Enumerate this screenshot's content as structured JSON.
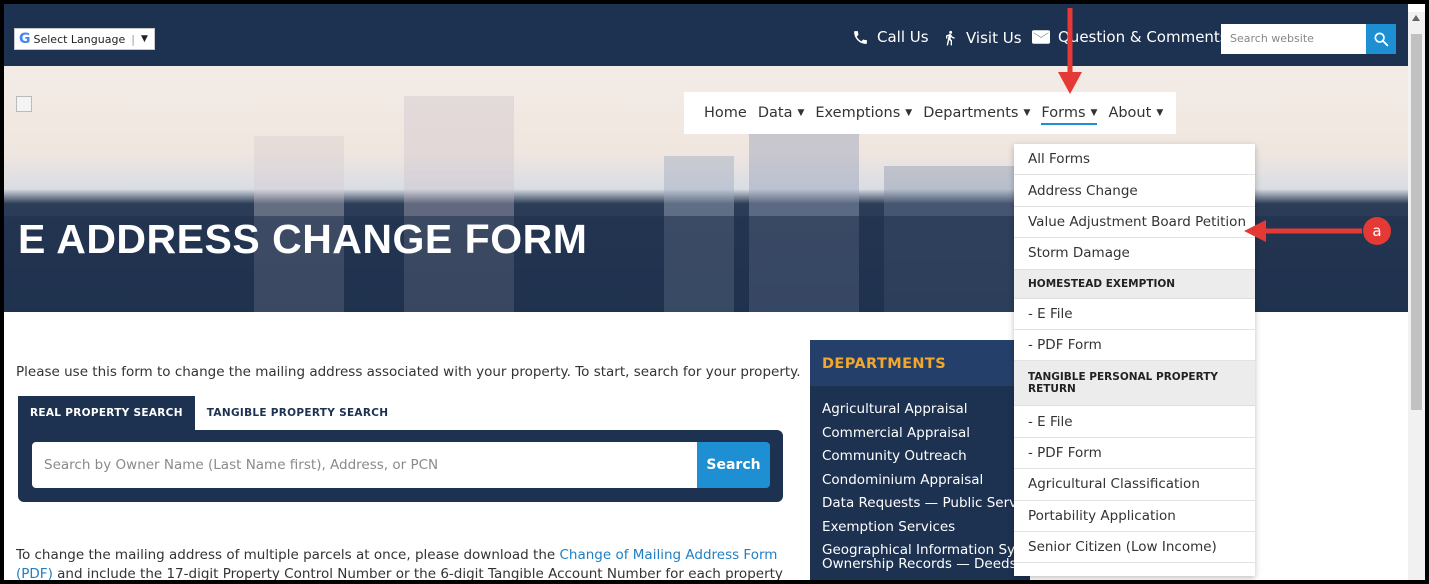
{
  "topbar": {
    "language_label": "Select Language",
    "call_label": "Call Us",
    "visit_label": "Visit Us",
    "question_label": "Question & Comments",
    "search_placeholder": "Search website"
  },
  "nav": {
    "items": [
      {
        "label": "Home"
      },
      {
        "label": "Data"
      },
      {
        "label": "Exemptions"
      },
      {
        "label": "Departments"
      },
      {
        "label": "Forms"
      },
      {
        "label": "About"
      }
    ]
  },
  "hero": {
    "title": "E ADDRESS CHANGE FORM"
  },
  "main": {
    "intro": "Please use this form to change the mailing address associated with your property. To start, search for your property.",
    "tabs": [
      {
        "label": "REAL PROPERTY SEARCH"
      },
      {
        "label": "TANGIBLE PROPERTY SEARCH"
      }
    ],
    "search_placeholder": "Search by Owner Name (Last Name first), Address, or PCN",
    "search_button": "Search",
    "bottom_text_pre": "To change the mailing address of multiple parcels at once, please download the ",
    "bottom_link_a": "Change of Mailing Address Form",
    "bottom_link_b": "(PDF)",
    "bottom_text_post": " and include the 17-digit Property Control Number or the 6-digit Tangible Account Number for each property"
  },
  "departments": {
    "heading": "DEPARTMENTS",
    "items": [
      "Agricultural Appraisal",
      "Commercial Appraisal",
      "Community Outreach",
      "Condominium Appraisal",
      "Data Requests — Public Servi",
      "Exemption Services",
      "Geographical Information Sys",
      "Ownership Records — Deeds"
    ]
  },
  "dropdown": {
    "items_a": [
      "All Forms",
      "Address Change",
      "Value Adjustment Board Petition",
      "Storm Damage"
    ],
    "head1": "HOMESTEAD EXEMPTION",
    "items_b": [
      "- E File",
      "- PDF Form"
    ],
    "head2_line1": "TANGIBLE PERSONAL PROPERTY",
    "head2_line2": "RETURN",
    "items_c": [
      "- E File",
      "- PDF Form",
      "Agricultural Classification",
      "Portability Application",
      "Senior Citizen (Low Income)"
    ]
  },
  "annotation": {
    "badge": "a",
    "color": "#e53935"
  },
  "colors": {
    "navy": "#1d3150",
    "accent": "#1f8fd4",
    "orange": "#f3a72b"
  }
}
